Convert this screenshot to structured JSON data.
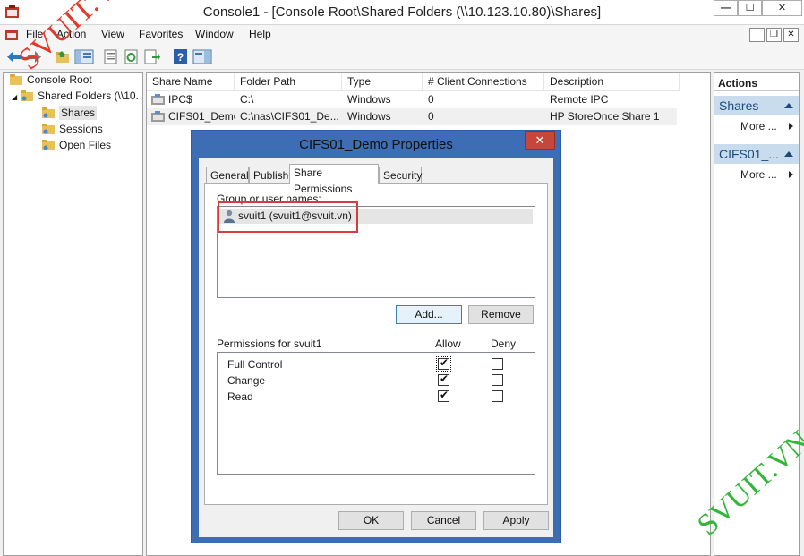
{
  "window": {
    "title": "Console1 - [Console Root\\Shared Folders (\\\\10.123.10.80)\\Shares]",
    "controls": {
      "minimize": "—",
      "maximize": "☐",
      "close": "✕"
    }
  },
  "menubar": {
    "items": [
      "File",
      "Action",
      "View",
      "Favorites",
      "Window",
      "Help"
    ],
    "mdi_controls": {
      "minimize": "_",
      "restore": "❐",
      "close": "✕"
    }
  },
  "toolbar": {
    "icons": [
      "back-arrow-icon",
      "forward-arrow-icon",
      "up-folder-icon",
      "show-hide-tree-icon",
      "properties-icon",
      "refresh-icon",
      "export-list-icon",
      "help-icon",
      "show-hide-action-pane-icon"
    ]
  },
  "tree": {
    "items": [
      {
        "label": "Console Root",
        "icon": "folder-icon"
      },
      {
        "label": "Shared Folders (\\\\10.",
        "icon": "shared-folders-icon",
        "expander": "◢"
      },
      {
        "label": "Shares",
        "icon": "shares-icon"
      },
      {
        "label": "Sessions",
        "icon": "sessions-icon"
      },
      {
        "label": "Open Files",
        "icon": "open-files-icon"
      }
    ]
  },
  "list": {
    "columns": [
      "Share Name",
      "Folder Path",
      "Type",
      "# Client Connections",
      "Description"
    ],
    "rows": [
      {
        "name": "IPC$",
        "path": "C:\\",
        "type": "Windows",
        "connections": "0",
        "description": "Remote IPC"
      },
      {
        "name": "CIFS01_Demo",
        "path": "C:\\nas\\CIFS01_De...",
        "type": "Windows",
        "connections": "0",
        "description": "HP StoreOnce Share 1"
      }
    ]
  },
  "actions": {
    "header": "Actions",
    "groups": [
      {
        "title": "Shares",
        "item": "More ..."
      },
      {
        "title": "CIFS01_...",
        "item": "More ..."
      }
    ]
  },
  "dialog": {
    "title": "CIFS01_Demo Properties",
    "close": "✕",
    "tabs": [
      "General",
      "Publish",
      "Share Permissions",
      "Security"
    ],
    "group_label": "Group or user names:",
    "user": "svuit1 (svuit1@svuit.vn)",
    "add_button": "Add...",
    "remove_button": "Remove",
    "permissions_label": "Permissions for svuit1",
    "allow_header": "Allow",
    "deny_header": "Deny",
    "permissions": [
      {
        "name": "Full Control",
        "allow": true,
        "deny": false
      },
      {
        "name": "Change",
        "allow": true,
        "deny": false
      },
      {
        "name": "Read",
        "allow": true,
        "deny": false
      }
    ],
    "ok_button": "OK",
    "cancel_button": "Cancel",
    "apply_button": "Apply",
    "tick": "✔"
  },
  "watermarks": {
    "top_left": "SVUIT.VN",
    "bottom_right": "SVUIT.VN"
  },
  "colors": {
    "dialog_frame": "#3c6db5",
    "actions_group": "#c9dcee",
    "highlight_box": "#d63c3c",
    "close_button": "#c7463a"
  }
}
